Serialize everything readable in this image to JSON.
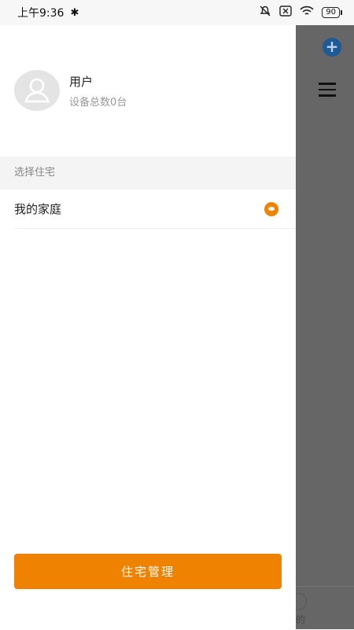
{
  "status_bar": {
    "time": "上午9:36",
    "battery": "90"
  },
  "drawer": {
    "user": {
      "name": "用户",
      "device_count": "设备总数0台"
    },
    "section_title": "选择住宅",
    "homes": [
      {
        "label": "我的家庭",
        "selected": true
      }
    ],
    "manage_button": "住宅管理"
  },
  "background": {
    "bottom_peek_text": "的"
  },
  "colors": {
    "accent": "#ef8200",
    "overlay": "#666666",
    "fab": "#1d5a96"
  }
}
